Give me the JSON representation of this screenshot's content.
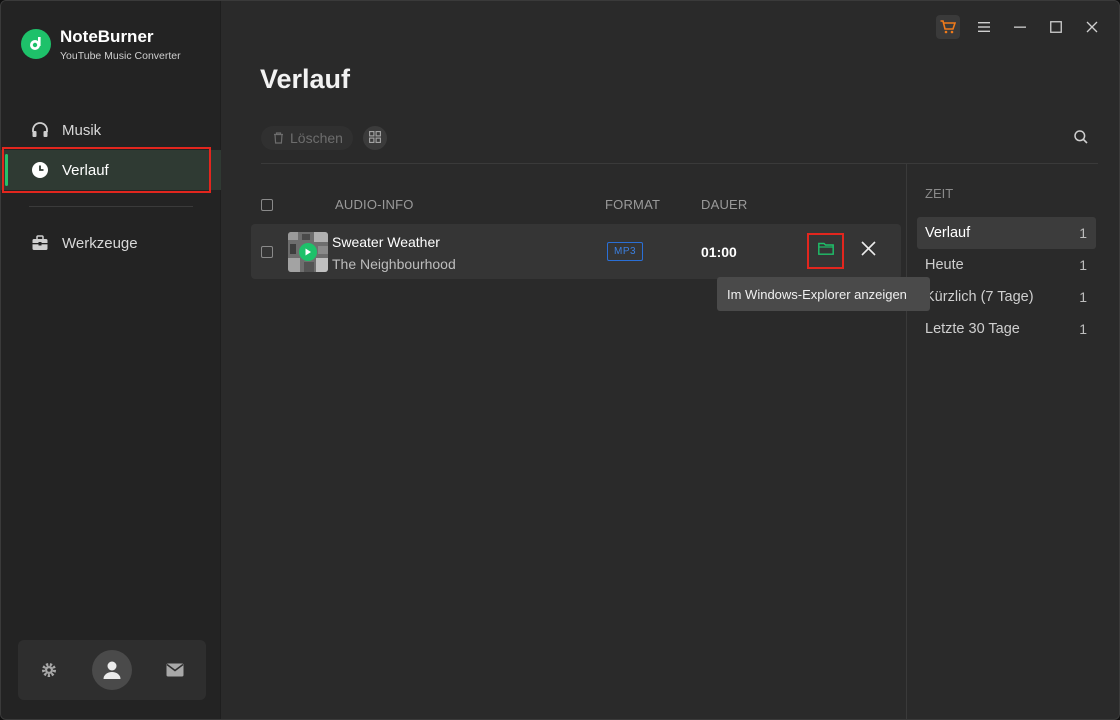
{
  "app": {
    "name": "NoteBurner",
    "subtitle": "YouTube Music Converter"
  },
  "sidebar": {
    "items": [
      {
        "label": "Musik",
        "icon": "headphones-icon"
      },
      {
        "label": "Verlauf",
        "icon": "clock-icon",
        "active": true
      },
      {
        "label": "Werkzeuge",
        "icon": "toolbox-icon"
      }
    ],
    "footer": [
      "gear-icon",
      "avatar-icon",
      "mail-icon"
    ]
  },
  "window_controls": [
    "cart-icon",
    "menu-icon",
    "minimize-icon",
    "maximize-icon",
    "close-icon"
  ],
  "main": {
    "title": "Verlauf",
    "delete_label": "Löschen",
    "columns": {
      "audio_info": "AUDIO-INFO",
      "format": "FORMAT",
      "duration": "DAUER"
    },
    "rows": [
      {
        "title": "Sweater Weather",
        "artist": "The Neighbourhood",
        "format": "MP3",
        "duration": "01:00"
      }
    ],
    "tooltip": "Im Windows-Explorer anzeigen"
  },
  "right_panel": {
    "header": "ZEIT",
    "items": [
      {
        "label": "Verlauf",
        "count": "1",
        "active": true
      },
      {
        "label": "Heute",
        "count": "1"
      },
      {
        "label": "Kürzlich (7 Tage)",
        "count": "1"
      },
      {
        "label": "Letzte 30 Tage",
        "count": "1"
      }
    ]
  },
  "colors": {
    "accent_green": "#1ec16a",
    "highlight_red": "#e2261e",
    "format_blue": "#2a6fd6",
    "cart_orange": "#f07a1a"
  }
}
